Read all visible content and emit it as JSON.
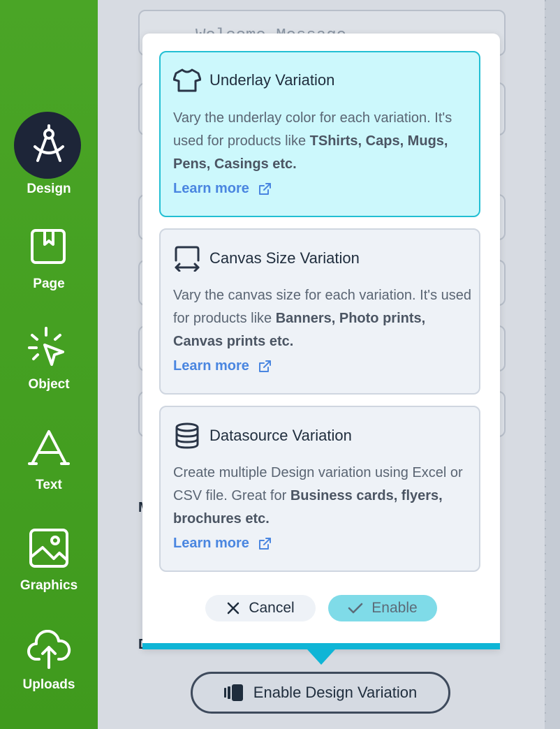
{
  "sidebar": {
    "items": [
      {
        "label": "Design",
        "icon": "compass-icon",
        "active": true
      },
      {
        "label": "Page",
        "icon": "page-bookmark-icon"
      },
      {
        "label": "Object",
        "icon": "pointer-click-icon"
      },
      {
        "label": "Text",
        "icon": "text-a-icon"
      },
      {
        "label": "Graphics",
        "icon": "image-icon"
      },
      {
        "label": "Uploads",
        "icon": "cloud-upload-icon"
      }
    ]
  },
  "background": {
    "field_placeholder": "Welcome Message",
    "partial_m": "M",
    "partial_d": "D"
  },
  "modal": {
    "cards": [
      {
        "title": "Underlay Variation",
        "icon": "tshirt-icon",
        "desc_plain": "Vary the underlay color for each variation. It's used for products like ",
        "desc_bold": "TShirts, Caps, Mugs, Pens, Casings etc.",
        "learn_more": "Learn more",
        "selected": true
      },
      {
        "title": "Canvas Size Variation",
        "icon": "canvas-resize-icon",
        "desc_plain": "Vary the canvas size for each variation. It's used for products like ",
        "desc_bold": "Banners, Photo prints, Canvas prints etc.",
        "learn_more": "Learn more",
        "selected": false
      },
      {
        "title": "Datasource Variation",
        "icon": "database-icon",
        "desc_plain": "Create multiple Design variation using Excel or CSV file. Great for ",
        "desc_bold": "Business cards, flyers, brochures etc.",
        "learn_more": "Learn more",
        "selected": false
      }
    ],
    "cancel_label": "Cancel",
    "enable_label": "Enable"
  },
  "enable_design_variation_label": "Enable Design Variation",
  "colors": {
    "sidebar_green": "#45a123",
    "active_navy": "#1d2538",
    "selected_card": "#ccf8fc",
    "accent_cyan": "#0fb5d6",
    "link_blue": "#4a86e0"
  }
}
